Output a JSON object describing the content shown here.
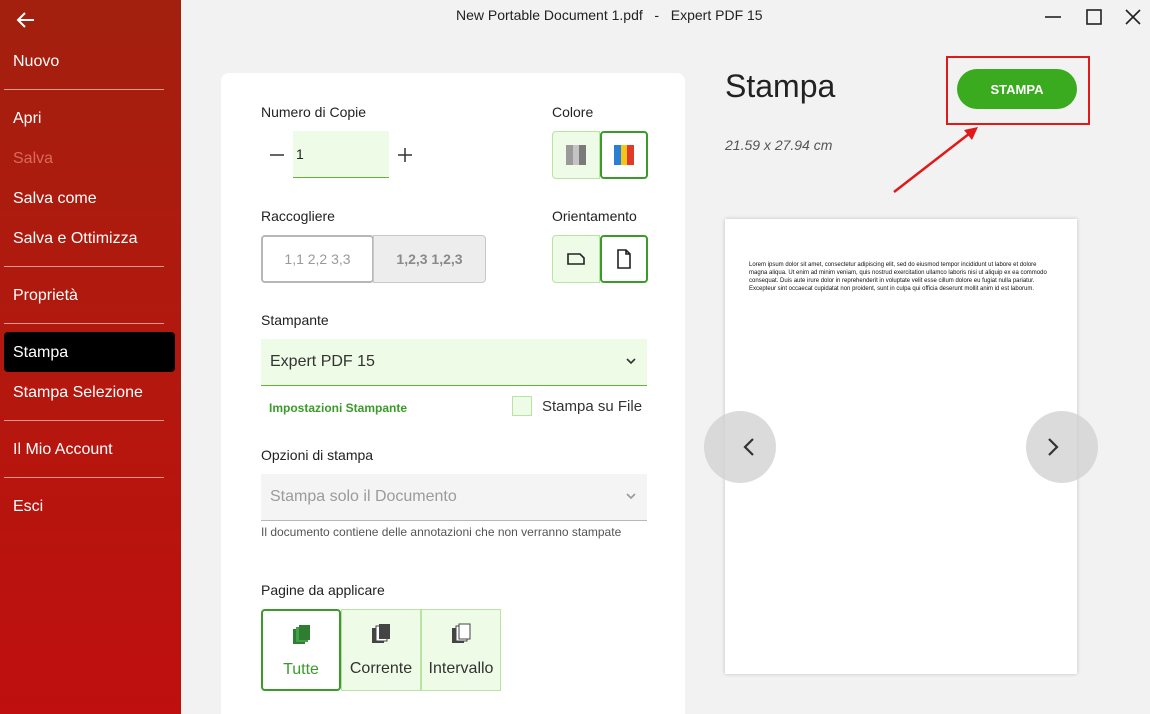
{
  "window": {
    "title": "New Portable Document 1.pdf   -   Expert PDF 15"
  },
  "sidebar": {
    "items": [
      {
        "label": "Nuovo"
      },
      {
        "label": "Apri"
      },
      {
        "label": "Salva"
      },
      {
        "label": "Salva come"
      },
      {
        "label": "Salva e Ottimizza"
      },
      {
        "label": "Proprietà"
      },
      {
        "label": "Stampa"
      },
      {
        "label": "Stampa Selezione"
      },
      {
        "label": "Il Mio Account"
      },
      {
        "label": "Esci"
      }
    ],
    "active": "Stampa"
  },
  "settings": {
    "copies_label": "Numero di Copie",
    "copies_value": "1",
    "color_label": "Colore",
    "collate_label": "Raccogliere",
    "collate_options": [
      "1,1 2,2 3,3",
      "1,2,3 1,2,3"
    ],
    "orientation_label": "Orientamento",
    "printer_label": "Stampante",
    "printer_value": "Expert PDF 15",
    "printer_settings_link": "Impostazioni Stampante",
    "print_to_file_label": "Stampa su File",
    "print_options_label": "Opzioni di stampa",
    "print_options_value": "Stampa solo il Documento",
    "print_options_note": "Il documento contiene delle annotazioni che non verranno stampate",
    "pages_label": "Pagine da applicare",
    "pages_options": [
      "Tutte",
      "Corrente",
      "Intervallo"
    ],
    "pages_selected": "Tutte"
  },
  "preview": {
    "title": "Stampa",
    "size": "21.59 x 27.94 cm",
    "print_button": "STAMPA",
    "page_text": "Lorem ipsum dolor sit amet, consectetur adipiscing elit, sed do eiusmod tempor incididunt ut labore et dolore magna aliqua. Ut enim ad minim veniam, quis nostrud exercitation ullamco laboris nisi ut aliquip ex ea commodo consequat. Duis aute irure dolor in reprehenderit in voluptate velit esse cillum dolore eu fugiat nulla pariatur. Excepteur sint occaecat cupidatat non proident, sunt in culpa qui officia deserunt mollit anim id est laborum."
  },
  "colors": {
    "sidebar": "#b01a0e",
    "accent_green": "#3aaa1f",
    "highlight_red": "#e01a1a"
  }
}
